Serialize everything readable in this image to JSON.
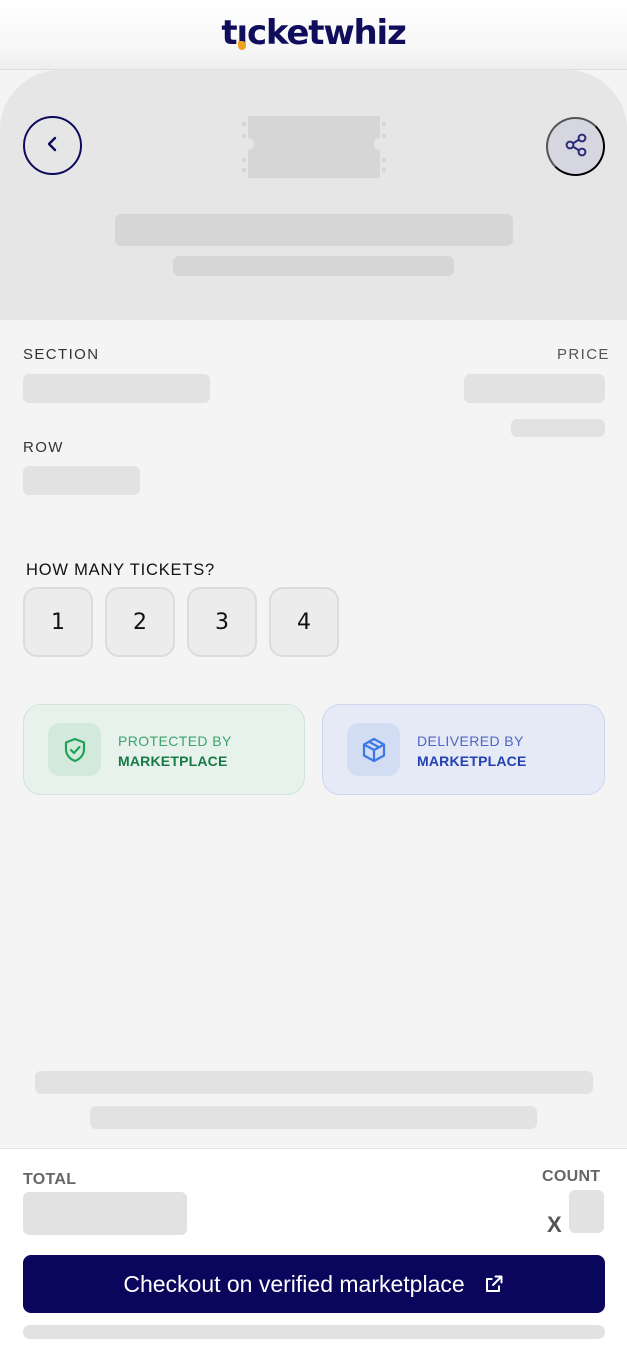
{
  "brand": {
    "logo_text_pre": "t",
    "logo_text_i": "ı",
    "logo_text_post": "cketwhiz",
    "primary_color": "#0f0d5c",
    "accent_color": "#f0a020"
  },
  "hero": {
    "back_icon": "chevron-left-icon",
    "share_icon": "share-icon"
  },
  "details": {
    "section_label": "SECTION",
    "price_label": "PRICE",
    "row_label": "ROW"
  },
  "quantity": {
    "title": "HOW MANY TICKETS?",
    "options": [
      "1",
      "2",
      "3",
      "4"
    ]
  },
  "badges": {
    "protected": {
      "line1": "PROTECTED BY",
      "line2": "MARKETPLACE",
      "icon": "shield-check-icon",
      "color": "#177a45"
    },
    "delivered": {
      "line1": "DELIVERED BY",
      "line2": "MARKETPLACE",
      "icon": "box-icon",
      "color": "#2340b0"
    }
  },
  "footer": {
    "total_label": "TOTAL",
    "count_label": "COUNT",
    "multiply_sign": "X",
    "checkout_label": "Checkout on verified marketplace",
    "checkout_icon": "external-link-icon",
    "checkout_color": "#0a065c"
  }
}
